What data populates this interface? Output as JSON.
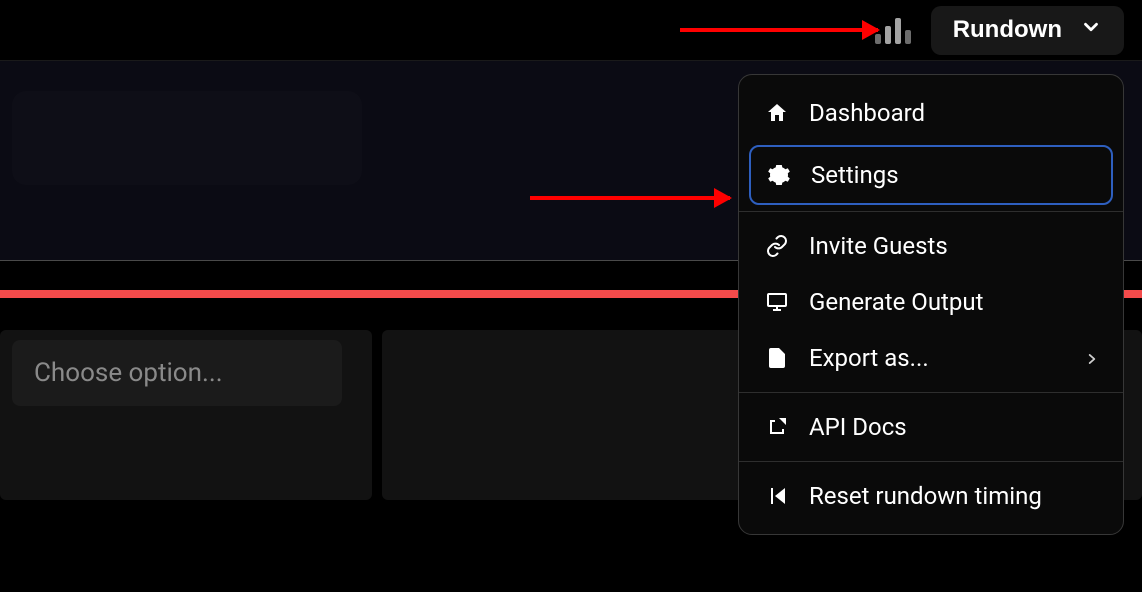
{
  "header": {
    "rundown_label": "Rundown"
  },
  "placeholder": {
    "choose_option": "Choose option..."
  },
  "menu": {
    "dashboard": "Dashboard",
    "settings": "Settings",
    "invite_guests": "Invite Guests",
    "generate_output": "Generate Output",
    "export_as": "Export as...",
    "api_docs": "API Docs",
    "reset_timing": "Reset rundown timing"
  }
}
